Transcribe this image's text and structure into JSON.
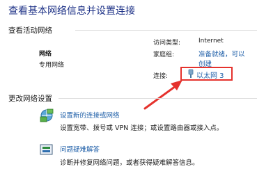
{
  "page_title": "查看基本网络信息并设置连接",
  "active_networks": {
    "section_title": "查看活动网络",
    "network_name": "网络",
    "network_type": "专用网络",
    "access_type_label": "访问类型:",
    "access_type_value": "Internet",
    "homegroup_label": "家庭组:",
    "homegroup_value_line1": "准备就绪，可以",
    "homegroup_value_line2": "创建",
    "connections_label": "连接:",
    "connection_value": "以太网 3"
  },
  "change_settings": {
    "section_title": "更改网络设置",
    "items": [
      {
        "title": "设置新的连接或网络",
        "description": "设置宽带、拨号或 VPN 连接；或设置路由器或接入点。",
        "icon": "network-setup-icon"
      },
      {
        "title": "问题疑难解答",
        "description": "诊断并修复网络问题，或者获得疑难解答信息。",
        "icon": "troubleshoot-icon"
      }
    ]
  },
  "colors": {
    "title": "#1e3287",
    "link": "#1f5fa8",
    "highlight": "#e5322d"
  }
}
